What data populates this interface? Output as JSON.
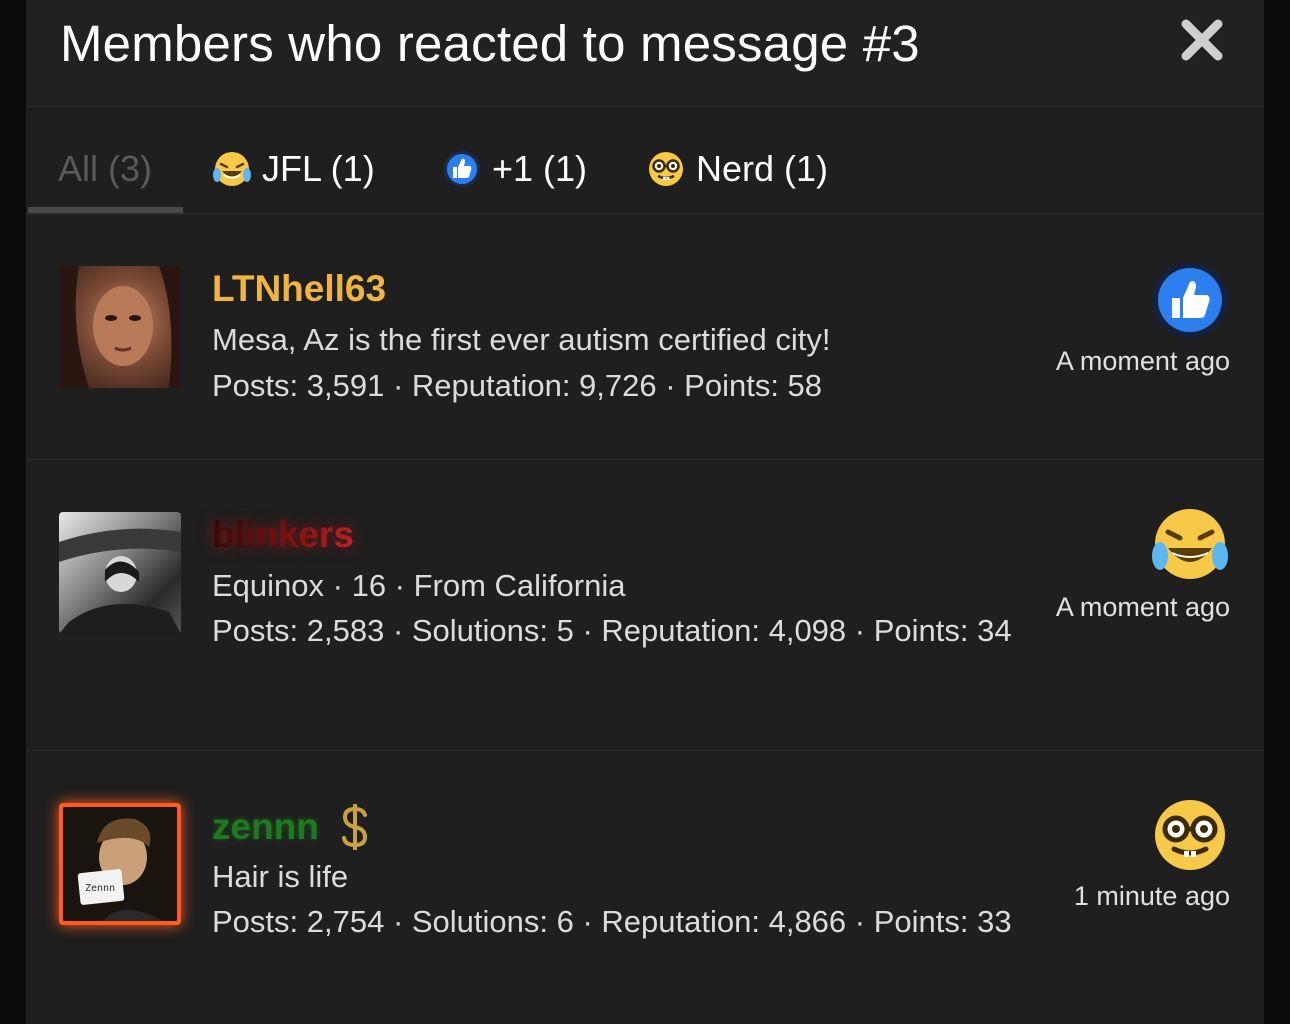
{
  "modal": {
    "title": "Members who reacted to message #3"
  },
  "tabs": [
    {
      "label": "All (3)",
      "active": true
    },
    {
      "label": "JFL (1)",
      "icon": "laughing-crying-emoji-icon"
    },
    {
      "label": "+1 (1)",
      "icon": "thumbs-up-icon"
    },
    {
      "label": "Nerd (1)",
      "icon": "nerd-emoji-icon"
    }
  ],
  "members": [
    {
      "username": "LTNhell63",
      "username_color": "#f0b442",
      "line1": "Mesa, Az is the first ever autism certified city!",
      "line2": "Posts: 3,591 · Reputation: 9,726 · Points: 58",
      "reaction_icon": "thumbs-up-icon",
      "time": "A moment ago"
    },
    {
      "username": "blinkers",
      "username_color": "#8b1a1a",
      "line1": "Equinox · 16 · From California",
      "line2": "Posts: 2,583 · Solutions: 5 · Reputation: 4,098 · Points: 34",
      "reaction_icon": "laughing-crying-emoji-icon",
      "time": "A moment ago"
    },
    {
      "username": "zennn",
      "username_color": "#1f8a1f",
      "badge_icon": "dollar-sign-icon",
      "line1": "Hair is life",
      "line2": "Posts: 2,754 · Solutions: 6 · Reputation: 4,866 · Points: 33",
      "reaction_icon": "nerd-emoji-icon",
      "time": "1 minute ago"
    }
  ],
  "colors": {
    "accent_orange": "#ff5a1f",
    "thumbs_blue": "#2d7ff0",
    "emoji_yellow": "#f7c948"
  }
}
